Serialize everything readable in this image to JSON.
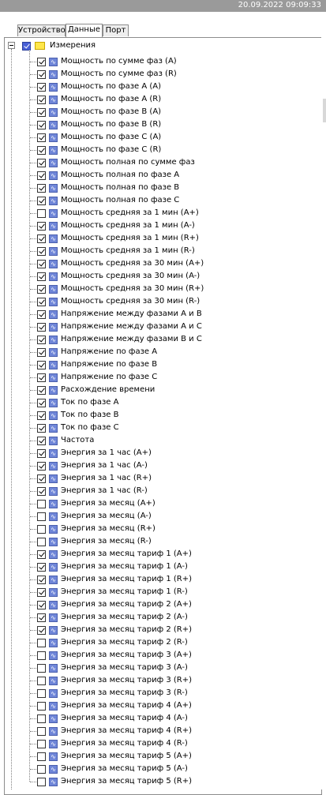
{
  "header": {
    "timestamp": "20.09.2022  09:09:33"
  },
  "tabs": [
    {
      "label": "Устройство",
      "active": false
    },
    {
      "label": "Данные",
      "active": true
    },
    {
      "label": "Порт",
      "active": false
    }
  ],
  "tree": {
    "root": {
      "label": "Измерения",
      "checked": true,
      "expanded": true
    },
    "items": [
      {
        "label": "Мощность по сумме фаз (A)",
        "checked": true
      },
      {
        "label": "Мощность по сумме фаз (R)",
        "checked": true
      },
      {
        "label": "Мощность по фазе A (A)",
        "checked": true
      },
      {
        "label": "Мощность по фазе A (R)",
        "checked": true
      },
      {
        "label": "Мощность по фазе B (A)",
        "checked": true
      },
      {
        "label": "Мощность по фазе B (R)",
        "checked": true
      },
      {
        "label": "Мощность по фазе C (A)",
        "checked": true
      },
      {
        "label": "Мощность по фазе C (R)",
        "checked": true
      },
      {
        "label": "Мощность полная по сумме фаз",
        "checked": true
      },
      {
        "label": "Мощность полная по фазе A",
        "checked": true
      },
      {
        "label": "Мощность полная по фазе B",
        "checked": true
      },
      {
        "label": "Мощность полная по фазе C",
        "checked": true
      },
      {
        "label": "Мощность средняя за 1 мин (A+)",
        "checked": false
      },
      {
        "label": "Мощность средняя за 1 мин (A-)",
        "checked": true
      },
      {
        "label": "Мощность средняя за 1 мин (R+)",
        "checked": true
      },
      {
        "label": "Мощность средняя за 1 мин (R-)",
        "checked": true
      },
      {
        "label": "Мощность средняя за 30 мин (A+)",
        "checked": true
      },
      {
        "label": "Мощность средняя за 30 мин (A-)",
        "checked": true
      },
      {
        "label": "Мощность средняя за 30 мин (R+)",
        "checked": true
      },
      {
        "label": "Мощность средняя за 30 мин (R-)",
        "checked": true
      },
      {
        "label": "Напряжение между фазами A и B",
        "checked": true
      },
      {
        "label": "Напряжение между фазами A и C",
        "checked": true
      },
      {
        "label": "Напряжение между фазами B и C",
        "checked": true
      },
      {
        "label": "Напряжение по фазе A",
        "checked": true
      },
      {
        "label": "Напряжение по фазе B",
        "checked": true
      },
      {
        "label": "Напряжение по фазе C",
        "checked": true
      },
      {
        "label": "Расхождение времени",
        "checked": true
      },
      {
        "label": "Ток по фазе A",
        "checked": true
      },
      {
        "label": "Ток по фазе B",
        "checked": true
      },
      {
        "label": "Ток по фазе C",
        "checked": true
      },
      {
        "label": "Частота",
        "checked": true
      },
      {
        "label": "Энергия за 1 час (A+)",
        "checked": true
      },
      {
        "label": "Энергия за 1 час (A-)",
        "checked": true
      },
      {
        "label": "Энергия за 1 час (R+)",
        "checked": true
      },
      {
        "label": "Энергия за 1 час (R-)",
        "checked": true
      },
      {
        "label": "Энергия за месяц (A+)",
        "checked": false
      },
      {
        "label": "Энергия за месяц (A-)",
        "checked": false
      },
      {
        "label": "Энергия за месяц (R+)",
        "checked": false
      },
      {
        "label": "Энергия за месяц (R-)",
        "checked": false
      },
      {
        "label": "Энергия за месяц тариф 1 (A+)",
        "checked": true
      },
      {
        "label": "Энергия за месяц тариф 1 (A-)",
        "checked": true
      },
      {
        "label": "Энергия за месяц тариф 1 (R+)",
        "checked": true
      },
      {
        "label": "Энергия за месяц тариф 1 (R-)",
        "checked": true
      },
      {
        "label": "Энергия за месяц тариф 2 (A+)",
        "checked": true
      },
      {
        "label": "Энергия за месяц тариф 2 (A-)",
        "checked": true
      },
      {
        "label": "Энергия за месяц тариф 2 (R+)",
        "checked": true
      },
      {
        "label": "Энергия за месяц тариф 2 (R-)",
        "checked": false
      },
      {
        "label": "Энергия за месяц тариф 3 (A+)",
        "checked": false
      },
      {
        "label": "Энергия за месяц тариф 3 (A-)",
        "checked": false
      },
      {
        "label": "Энергия за месяц тариф 3 (R+)",
        "checked": false
      },
      {
        "label": "Энергия за месяц тариф 3 (R-)",
        "checked": false
      },
      {
        "label": "Энергия за месяц тариф 4 (A+)",
        "checked": false
      },
      {
        "label": "Энергия за месяц тариф 4 (A-)",
        "checked": false
      },
      {
        "label": "Энергия за месяц тариф 4 (R+)",
        "checked": false
      },
      {
        "label": "Энергия за месяц тариф 4 (R-)",
        "checked": false
      },
      {
        "label": "Энергия за месяц тариф 5 (A+)",
        "checked": false
      },
      {
        "label": "Энергия за месяц тариф 5 (A-)",
        "checked": false
      },
      {
        "label": "Энергия за месяц тариф 5 (R+)",
        "checked": false
      }
    ]
  },
  "colors": {
    "topbar": "#9a9a9a",
    "checkbox_root": "#4960d6",
    "signal_icon": "#6f86d8",
    "folder_icon": "#ffe64a"
  },
  "icons": {
    "root": "folder-icon",
    "item": "signal-icon",
    "expander": "collapse-icon"
  }
}
